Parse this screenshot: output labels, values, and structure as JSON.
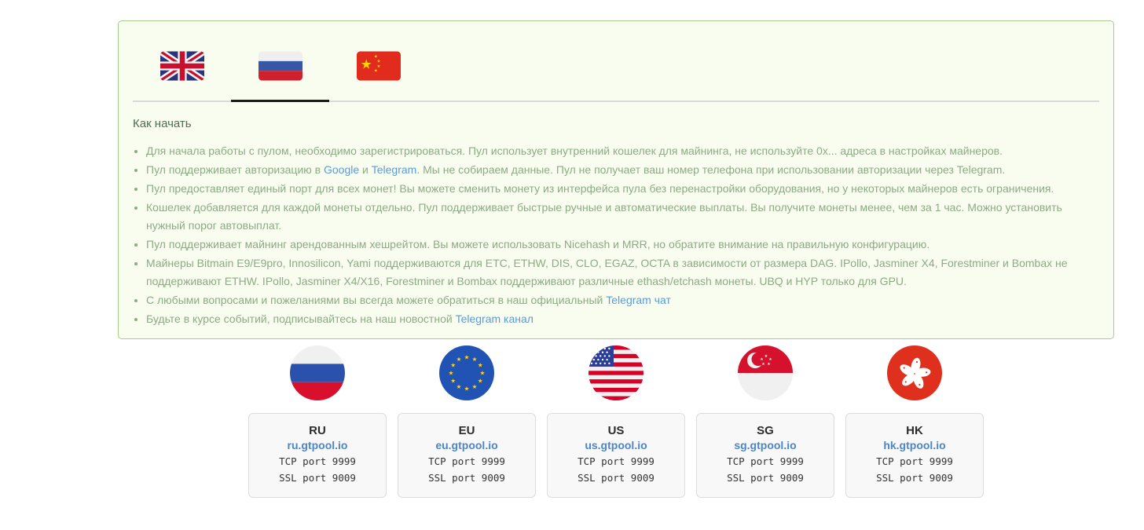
{
  "panel": {
    "heading": "Как начать",
    "tabs": [
      {
        "id": "en",
        "icon": "uk-flag-icon",
        "active": false
      },
      {
        "id": "ru",
        "icon": "ru-flag-icon",
        "active": true
      },
      {
        "id": "zh",
        "icon": "cn-flag-icon",
        "active": false
      }
    ],
    "bullets": [
      [
        {
          "t": "Для начала работы с пулом, необходимо зарегистрироваться. Пул использует внутренний кошелек для майнинга, не используйте 0x... адреса в настройках майнеров."
        }
      ],
      [
        {
          "t": "Пул поддерживает авторизацию в "
        },
        {
          "t": "Google",
          "link": true
        },
        {
          "t": " и "
        },
        {
          "t": "Telegram",
          "link": true
        },
        {
          "t": ". Мы не собираем данные. Пул не получает ваш номер телефона при использовании авторизации через Telegram."
        }
      ],
      [
        {
          "t": "Пул предоставляет единый порт для всех монет! Вы можете сменить монету из интерфейса пула без перенастройки оборудования, но у некоторых майнеров есть ограничения."
        }
      ],
      [
        {
          "t": "Кошелек добавляется для каждой монеты отдельно. Пул поддерживает быстрые ручные и автоматические выплаты. Вы получите монеты менее, чем за 1 час. Можно установить нужный порог автовыплат."
        }
      ],
      [
        {
          "t": "Пул поддерживает майнинг арендованным хешрейтом. Вы можете использовать Nicehash и MRR, но обратите внимание на правильную конфигурацию."
        }
      ],
      [
        {
          "t": "Майнеры Bitmain E9/E9pro, Innosilicon, Yami поддерживаются для ETC, ETHW, DIS, CLO, EGAZ, OCTA в зависимости от размера DAG. IPollo, Jasminer X4, Forestminer и Bombax не поддерживают ETHW. IPollo, Jasminer X4/X16, Forestminer и Bombax поддерживают различные ethash/etchash монеты. UBQ и HYP только для GPU."
        }
      ],
      [
        {
          "t": "С любыми вопросами и пожеланиями вы всегда можете обратиться в наш официальный "
        },
        {
          "t": "Telegram чат",
          "link": true
        }
      ],
      [
        {
          "t": "Будьте в курсе событий, подписывайтесь на наш новостной "
        },
        {
          "t": "Telegram канал",
          "link": true
        }
      ]
    ]
  },
  "servers": [
    {
      "code": "RU",
      "host": "ru.gtpool.io",
      "tcp": "TCP port 9999",
      "ssl": "SSL port 9009",
      "icon": "ru-circle-flag-icon"
    },
    {
      "code": "EU",
      "host": "eu.gtpool.io",
      "tcp": "TCP port 9999",
      "ssl": "SSL port 9009",
      "icon": "eu-circle-flag-icon"
    },
    {
      "code": "US",
      "host": "us.gtpool.io",
      "tcp": "TCP port 9999",
      "ssl": "SSL port 9009",
      "icon": "us-circle-flag-icon"
    },
    {
      "code": "SG",
      "host": "sg.gtpool.io",
      "tcp": "TCP port 9999",
      "ssl": "SSL port 9009",
      "icon": "sg-circle-flag-icon"
    },
    {
      "code": "HK",
      "host": "hk.gtpool.io",
      "tcp": "TCP port 9999",
      "ssl": "SSL port 9009",
      "icon": "hk-circle-flag-icon"
    }
  ],
  "colors": {
    "panel_bg": "#f9fdf0",
    "panel_border": "#a6cd8c",
    "divider": "#d9d9d9",
    "tab_underline": "#1a1a1a",
    "heading_text": "#4d6e4f",
    "body_text": "#8caa83",
    "link_blue": "#5b9bd5",
    "host_link": "#4a86c8",
    "card_bg": "#f8f8f8",
    "card_border": "#dddddd"
  }
}
